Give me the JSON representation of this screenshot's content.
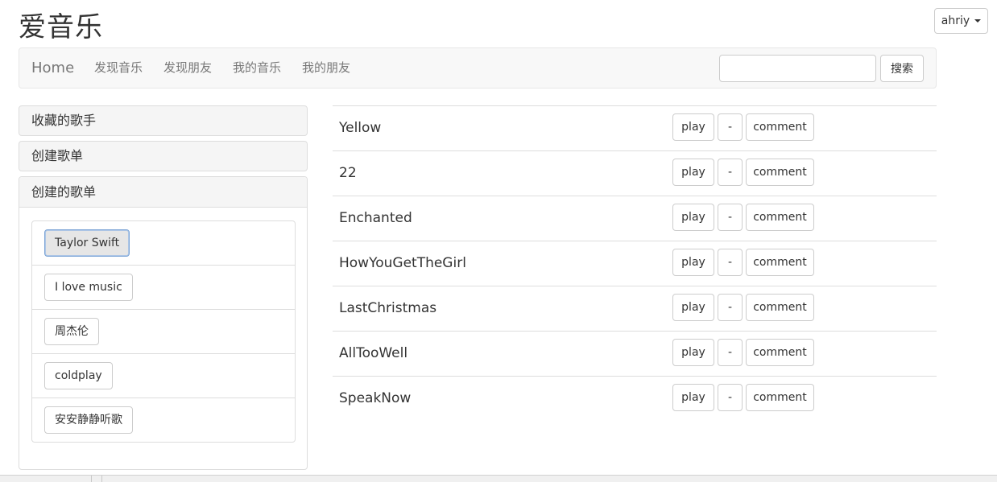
{
  "brand": "爱音乐",
  "user_menu": {
    "label": "ahriy"
  },
  "navbar": {
    "home": "Home",
    "links": [
      "发现音乐",
      "发现朋友",
      "我的音乐",
      "我的朋友"
    ],
    "search_placeholder": "",
    "search_button": "搜索"
  },
  "sidebar": {
    "panels": [
      "收藏的歌手",
      "创建歌单"
    ],
    "open_panel": {
      "title": "创建的歌单",
      "items": [
        "Taylor Swift",
        "I love music",
        "周杰伦",
        "coldplay",
        "安安静静听歌"
      ],
      "active_index": 0
    }
  },
  "songs": {
    "button_labels": {
      "play": "play",
      "remove": "-",
      "comment": "comment"
    },
    "rows": [
      "Yellow",
      "22",
      "Enchanted",
      "HowYouGetTheGirl",
      "LastChristmas",
      "AllTooWell",
      "SpeakNow"
    ]
  }
}
